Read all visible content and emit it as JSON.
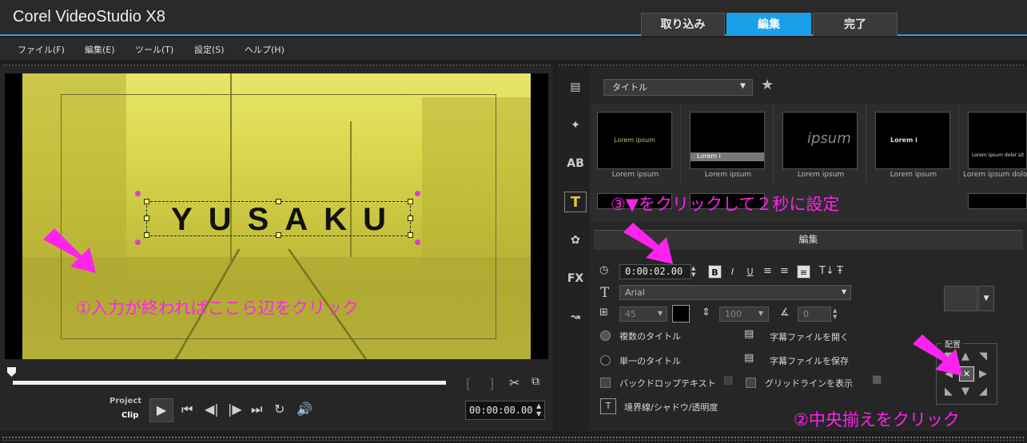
{
  "app": {
    "title": "Corel  VideoStudio X8"
  },
  "top_tabs": [
    {
      "label": "取り込み"
    },
    {
      "label": "編集"
    },
    {
      "label": "完了"
    }
  ],
  "menu": [
    {
      "label": "ファイル(F)"
    },
    {
      "label": "編集(E)"
    },
    {
      "label": "ツール(T)"
    },
    {
      "label": "設定(S)"
    },
    {
      "label": "ヘルプ(H)"
    }
  ],
  "preview": {
    "title_text": "YUSAKU",
    "project_label": "Project",
    "clip_label": "Clip",
    "timecode": "00:00:00.00",
    "bracket_in": "[",
    "bracket_out": "]"
  },
  "annotations": {
    "step1": "①入力が終わればここら辺をクリック",
    "step2": "②中央揃えをクリック",
    "step3": "③▼をクリックして２秒に設定"
  },
  "library": {
    "category": "タイトル",
    "thumbnails": [
      {
        "preview": "Lorem ipsum",
        "label": "Lorem ipsum"
      },
      {
        "preview": "Lorem i",
        "label": "Lorem ipsum"
      },
      {
        "preview": "ipsum",
        "label": "Lorem ipsum"
      },
      {
        "preview": "Lorem i",
        "label": "Lorem ipsum"
      },
      {
        "preview": "Lorem ipsum dolor sit",
        "label": "Lorem ipsum dolo"
      }
    ]
  },
  "options": {
    "header": "編集",
    "duration": "0:00:02.00",
    "font": "Arial",
    "font_size": "45",
    "line_spacing": "100",
    "angle": "0",
    "radio_multi": "複数のタイトル",
    "radio_single": "単一のタイトル",
    "open_subtitle": "字幕ファイルを開く",
    "save_subtitle": "字幕ファイルを保存",
    "backdrop": "バックドロップテキスト",
    "gridlines": "グリッドラインを表示",
    "border_shadow": "境界線/シャドウ/透明度",
    "alignment_label": "配置",
    "bold": "B",
    "italic": "I",
    "underline": "U"
  },
  "colors": {
    "accent": "#1aa0e8",
    "annotation": "#ff22ee",
    "video_tint": "#d9d64c"
  }
}
